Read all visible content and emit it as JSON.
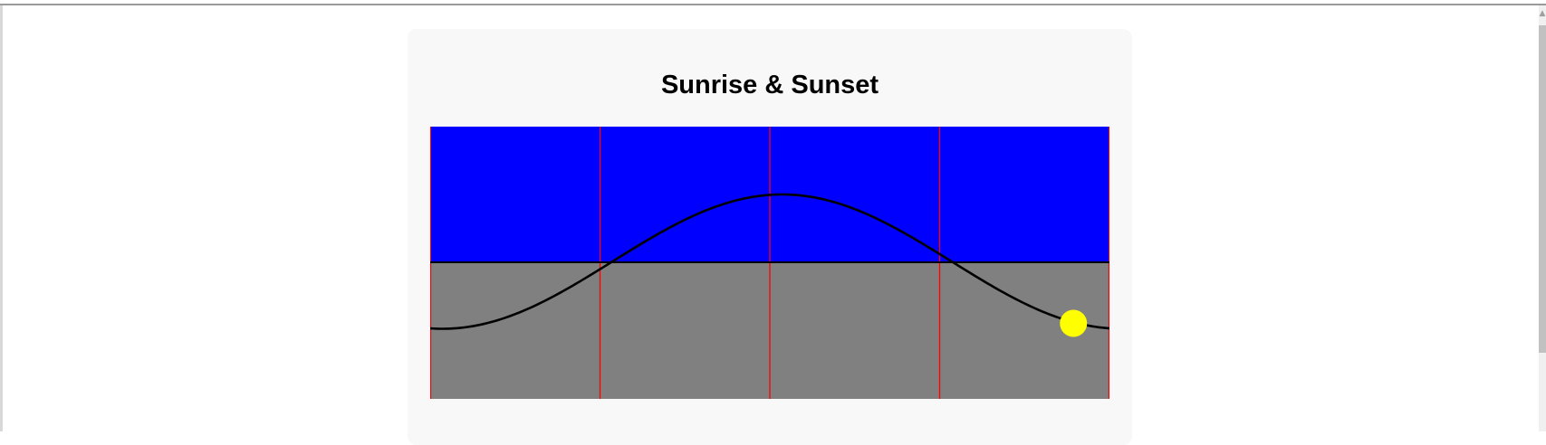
{
  "page": {
    "title": "Sunrise & Sunset"
  },
  "colors": {
    "sky": "#0000ff",
    "ground": "#808080",
    "horizon": "#000000",
    "grid": "#ff0000",
    "curve": "#000000",
    "sun": "#ffff00"
  },
  "chart_data": {
    "type": "line",
    "title": "Sunrise & Sunset",
    "xlabel": "",
    "ylabel": "",
    "x_range": [
      0,
      1
    ],
    "y_range": [
      -1,
      1
    ],
    "horizon_y": 0,
    "sun_position": {
      "x": 0.947,
      "y": -0.45
    }
  },
  "icons": {
    "scroll_up": "scroll-up-arrow-icon",
    "sun": "sun-icon"
  }
}
